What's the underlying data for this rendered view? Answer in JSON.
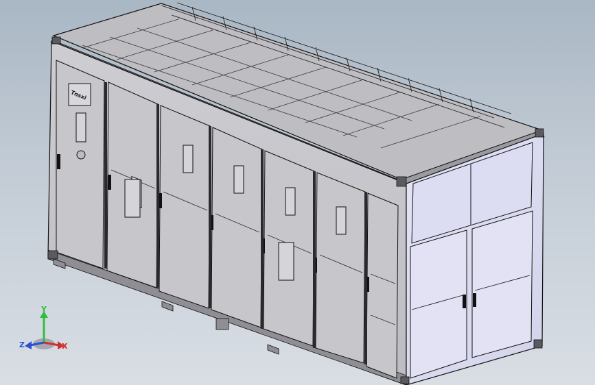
{
  "viewport": {
    "background_top": "#a9b7c4",
    "background_bottom": "#d9dee4"
  },
  "model": {
    "panel_text": "Tnsxi",
    "colors": {
      "panel_face": "#c4c4c9",
      "panel_face_light": "#d0d0d5",
      "end_face": "#dcdcf2",
      "end_frame": "#e4e4f4",
      "roof": "#bdbdc2",
      "frame": "#9a9aa1",
      "edge": "#111111",
      "foot": "#8e8e94"
    }
  },
  "triad": {
    "x_label": "X",
    "y_label": "Y",
    "z_label": "Z",
    "x_color": "#d12f2f",
    "y_color": "#2fbf3a",
    "z_color": "#2f4fd1"
  }
}
